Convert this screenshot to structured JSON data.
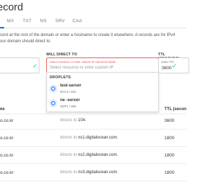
{
  "page": {
    "title": "ecord"
  },
  "tabs": [
    {
      "label": "MX"
    },
    {
      "label": "TXT"
    },
    {
      "label": "NS"
    },
    {
      "label": "SRV"
    },
    {
      "label": "CAA"
    }
  ],
  "description": {
    "line1": "cord at the root of the domain or enter a hostname to create it elsewhere. A records are for IPv4",
    "line2": "our domain should direct to."
  },
  "form": {
    "will_direct_label": "WILL DIRECT TO",
    "ttl_label": "TTL (SECONDS)",
    "error_text": "Select resource or enter custom IP cannot be blank",
    "direct_placeholder": "Select resource or enter custom IP",
    "ttl_small_label": "Enter TTL",
    "ttl_value": "3600"
  },
  "dropdown": {
    "header": "DROPLETS",
    "items": [
      {
        "name": "test-server",
        "sub": "NYC3 / 104."
      },
      {
        "name": "ne      -server",
        "sub": "SGP1 / 206."
      }
    ]
  },
  "table": {
    "headers": {
      "host": "me",
      "ttl": "TTL (secon"
    },
    "rows": [
      {
        "host": "o.co.kr",
        "direct_prefix": "directs to",
        "direct_value": "104.",
        "ttl": "3600"
      },
      {
        "host": "o.co.kr",
        "direct_prefix": "directs to",
        "direct_value": "ns1.digitalocean.com.",
        "ttl": "1800"
      },
      {
        "host": "o.co.kr",
        "direct_prefix": "directs to",
        "direct_value": "ns2.digitalocean.com.",
        "ttl": "1800"
      },
      {
        "host": "o.co.kr",
        "direct_prefix": "directs to",
        "direct_value": "ns3.digitalocean.com.",
        "ttl": "1800"
      }
    ]
  }
}
